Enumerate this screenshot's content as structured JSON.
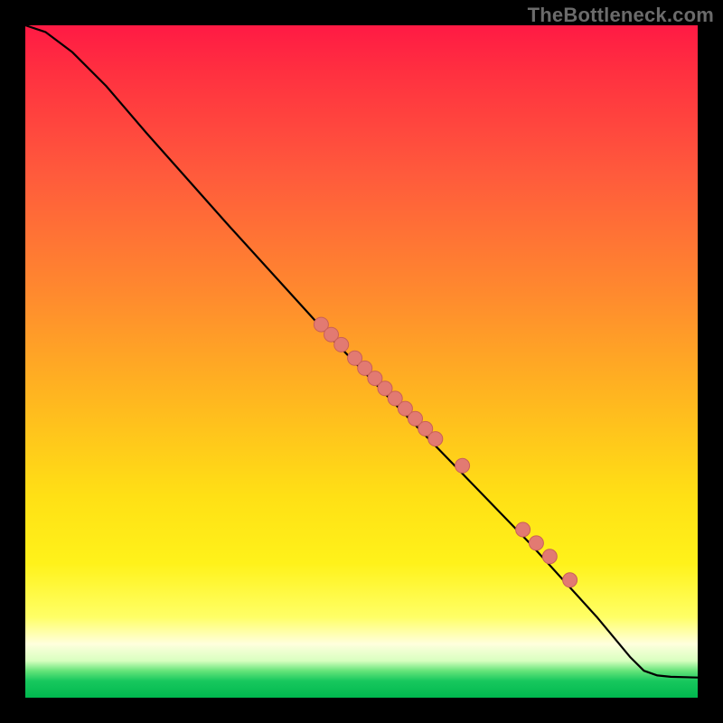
{
  "watermark": "TheBottleneck.com",
  "chart_data": {
    "type": "line",
    "title": "",
    "xlabel": "",
    "ylabel": "",
    "xlim": [
      0,
      100
    ],
    "ylim": [
      0,
      100
    ],
    "grid": false,
    "legend": false,
    "curve": [
      {
        "x": 0,
        "y": 100
      },
      {
        "x": 3,
        "y": 99
      },
      {
        "x": 7,
        "y": 96
      },
      {
        "x": 12,
        "y": 91
      },
      {
        "x": 18,
        "y": 84
      },
      {
        "x": 30,
        "y": 70.5
      },
      {
        "x": 45,
        "y": 54
      },
      {
        "x": 60,
        "y": 38.5
      },
      {
        "x": 75,
        "y": 23
      },
      {
        "x": 85,
        "y": 12
      },
      {
        "x": 90,
        "y": 6
      },
      {
        "x": 92,
        "y": 4
      },
      {
        "x": 94,
        "y": 3.3
      },
      {
        "x": 96,
        "y": 3.1
      },
      {
        "x": 100,
        "y": 3
      }
    ],
    "points": [
      {
        "x": 44,
        "y": 55.5
      },
      {
        "x": 45.5,
        "y": 54
      },
      {
        "x": 47,
        "y": 52.5
      },
      {
        "x": 49,
        "y": 50.5
      },
      {
        "x": 50.5,
        "y": 49
      },
      {
        "x": 52,
        "y": 47.5
      },
      {
        "x": 53.5,
        "y": 46
      },
      {
        "x": 55,
        "y": 44.5
      },
      {
        "x": 56.5,
        "y": 43
      },
      {
        "x": 58,
        "y": 41.5
      },
      {
        "x": 59.5,
        "y": 40
      },
      {
        "x": 61,
        "y": 38.5
      },
      {
        "x": 65,
        "y": 34.5
      },
      {
        "x": 74,
        "y": 25
      },
      {
        "x": 76,
        "y": 23
      },
      {
        "x": 78,
        "y": 21
      },
      {
        "x": 81,
        "y": 17.5
      }
    ],
    "colors": {
      "curve": "#000000",
      "point_fill": "#e27a72",
      "point_stroke": "#c96058",
      "gradient_top": "#ff1a44",
      "gradient_mid": "#ffe015",
      "gradient_bottom": "#00b84e",
      "frame": "#000000"
    }
  }
}
